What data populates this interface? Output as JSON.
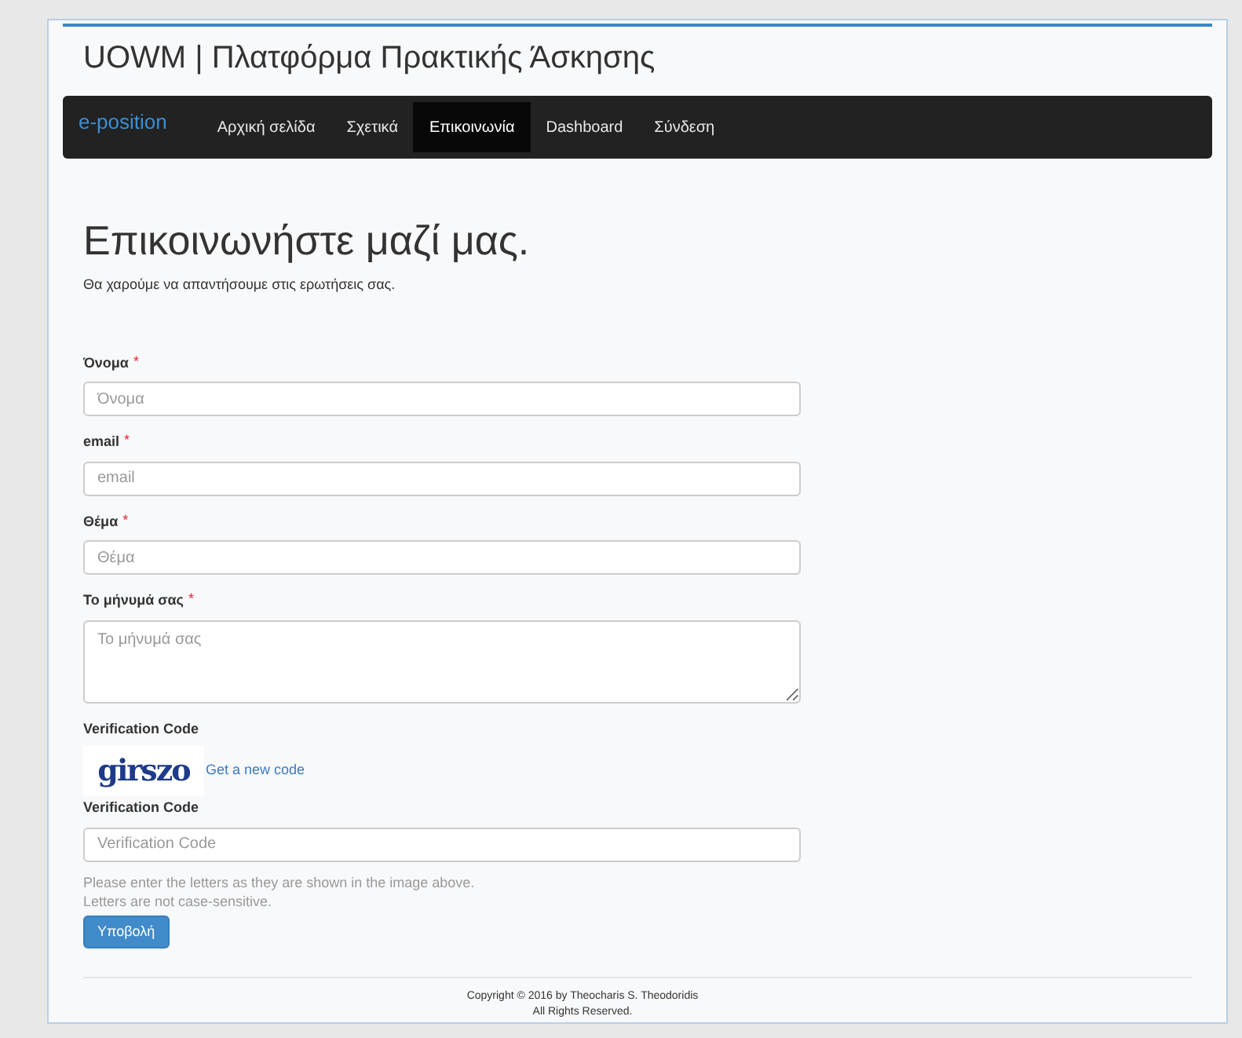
{
  "site_title": "UOWM | Πλατφόρμα Πρακτικής Άσκησης",
  "navbar": {
    "brand": "e-position",
    "items": [
      {
        "label": "Αρχική σελίδα",
        "selected": false
      },
      {
        "label": "Σχετικά",
        "selected": false
      },
      {
        "label": "Επικοινωνία",
        "selected": true
      },
      {
        "label": "Dashboard",
        "selected": false
      },
      {
        "label": "Σύνδεση",
        "selected": false
      }
    ]
  },
  "heading": "Επικοινωνήστε μαζί μας.",
  "subheading": "Θα χαρούμε να απαντήσουμε στις ερωτήσεις σας.",
  "fields": [
    {
      "kind": "input",
      "label": "Όνομα",
      "required_mark": "*",
      "placeholder": "Όνομα"
    },
    {
      "kind": "input",
      "label": "email",
      "required_mark": "*",
      "placeholder": "email"
    },
    {
      "kind": "input",
      "label": "Θέμα",
      "required_mark": "*",
      "placeholder": "Θέμα"
    },
    {
      "kind": "textarea",
      "label": "Το μήνυμά σας",
      "required_mark": "*",
      "placeholder": "Το μήνυμά σας"
    }
  ],
  "captcha": {
    "label": "Verification Code",
    "image_text": "girszo",
    "new_code_link": "Get a new code",
    "field_label": "Verification Code",
    "placeholder": "Verification Code",
    "hints": [
      "Please enter the letters as they are shown in the image above.",
      "Letters are not case-sensitive."
    ]
  },
  "submit_button": "Υποβολή",
  "footer": [
    "Copyright © 2016 by Theocharis S. Theodoridis",
    "All Rights Reserved."
  ]
}
